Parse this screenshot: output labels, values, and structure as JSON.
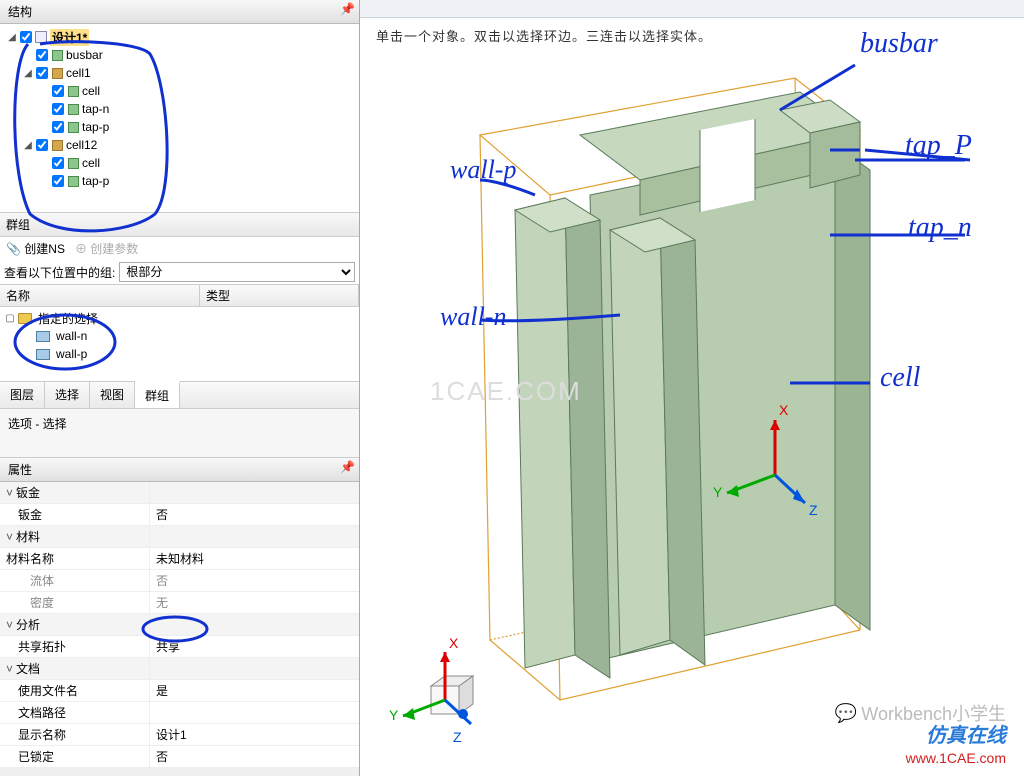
{
  "panel": {
    "structure_title": "结构",
    "groups_title": "群组",
    "props_title": "属性",
    "sel_label": "选项 - 选择"
  },
  "tree": {
    "design": "设计1*",
    "n0": "busbar",
    "n1": "cell1",
    "n1a": "cell",
    "n1b": "tap-n",
    "n1c": "tap-p",
    "n2": "cell12",
    "n2a": "cell",
    "n2b": "tap-p"
  },
  "groups": {
    "create_ns": "创建NS",
    "create_param": "创建参数",
    "lookup_label": "查看以下位置中的组:",
    "lookup_value": "根部分",
    "col_name": "名称",
    "col_type": "类型",
    "folder": "指定的选择",
    "wall_n": "wall-n",
    "wall_p": "wall-p"
  },
  "tabs": {
    "t0": "图层",
    "t1": "选择",
    "t2": "视图",
    "t3": "群组"
  },
  "props": {
    "h0": "钣金",
    "r0k": "钣金",
    "r0v": "否",
    "h1": "材料",
    "r1k": "材料名称",
    "r1v": "未知材料",
    "r2k": "流体",
    "r2v": "否",
    "r3k": "密度",
    "r3v": "无",
    "h2": "分析",
    "r4k": "共享拓扑",
    "r4v": "共享",
    "h3": "文档",
    "r5k": "使用文件名",
    "r5v": "是",
    "r6k": "文档路径",
    "r6v": "",
    "r7k": "显示名称",
    "r7v": "设计1",
    "r8k": "已锁定",
    "r8v": "否"
  },
  "viewport": {
    "hint": "单击一个对象。双击以选择环边。三连击以选择实体。",
    "watermark_center": "1CAE.COM",
    "wm_logo": "Workbench小学生",
    "wm_text": "仿真在线",
    "wm_url": "www.1CAE.com"
  },
  "annot": {
    "busbar": "busbar",
    "tap_p": "tap_P",
    "tap_n": "tap_n",
    "cell": "cell",
    "wall_p": "wall-p",
    "wall_n": "wall-n"
  },
  "axes": {
    "x": "X",
    "y": "Y",
    "z": "Z"
  }
}
